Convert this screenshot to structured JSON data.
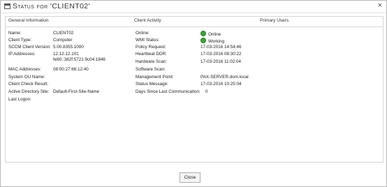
{
  "window": {
    "title": "Status for 'CLIENT02'",
    "close_glyph": "×",
    "close_button": "Close"
  },
  "columns": {
    "general": "General Information",
    "activity": "Client Activity",
    "users": "Primary Users"
  },
  "general": [
    {
      "label": "Name:",
      "value": "CLIENT02"
    },
    {
      "label": "Client Type:",
      "value": "Computer"
    },
    {
      "label": "SCCM Client Version:",
      "value": "5.00.8355.1000"
    },
    {
      "label": "IP Addresses:",
      "value": "12.12.12.101",
      "value2": "fe80::382f:5721:9c04:1846"
    },
    {
      "label": "MAC Addresses:",
      "value": "08:00:27:66:12:40"
    },
    {
      "label": "System OU Name:",
      "value": ""
    },
    {
      "label": "Client Check Result:",
      "value": ""
    },
    {
      "label": "Active Directory Site:",
      "value": "Default-First-Site-Name"
    },
    {
      "label": "Last Logon:",
      "value": ""
    }
  ],
  "activity": [
    {
      "label": "Online:",
      "value": "Online",
      "status": "green"
    },
    {
      "label": "WMI Status:",
      "value": "Working",
      "status": "green"
    },
    {
      "label": "Policy Request:",
      "value": "17-03-2016 14:54:46"
    },
    {
      "label": "Heartbeat DDR:",
      "value": "17-03-2016 08:30:22"
    },
    {
      "label": "Hardware Scan:",
      "value": "17-03-2016 11:02:04"
    },
    {
      "label": "Software Scan:",
      "value": ""
    },
    {
      "label": "Management Point:",
      "value": "PAX-SERVER.dom.local"
    },
    {
      "label": "Status Message:",
      "value": "17-03-2016 10:25:04"
    },
    {
      "label": "Days Since Last Communication:",
      "value": "0"
    }
  ],
  "colors": {
    "status_green": "#3ba635"
  },
  "icons": {
    "title": "window-icon",
    "close": "close-icon",
    "status": "green-status-dot-icon"
  }
}
